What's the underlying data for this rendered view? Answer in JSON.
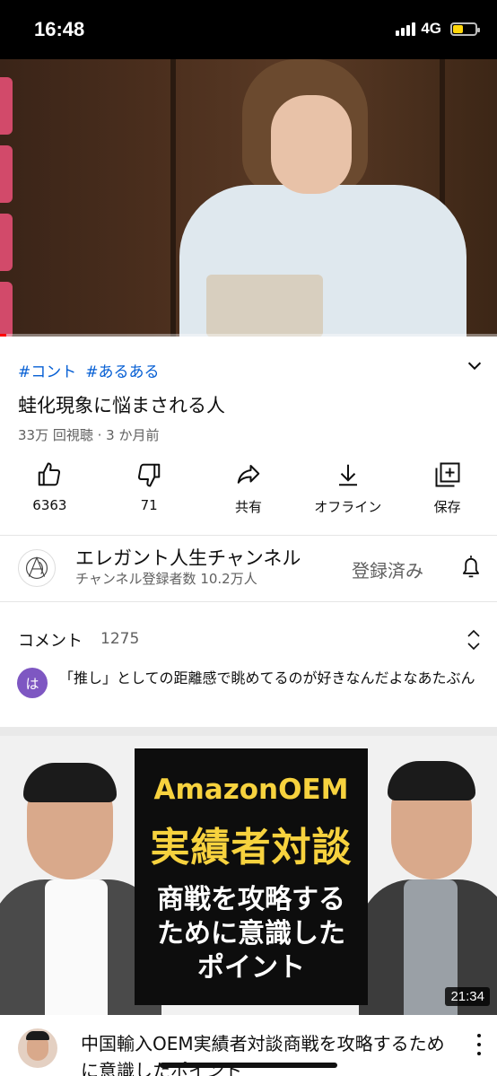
{
  "status_bar": {
    "time": "16:48",
    "network": "4G",
    "battery_fraction": 0.42
  },
  "video": {
    "hashtags": [
      "#コント",
      "#あるある"
    ],
    "title": "蛙化現象に悩まされる人",
    "meta": "33万 回視聴 · 3 か月前",
    "progress_fraction": 0.013
  },
  "actions": [
    {
      "icon": "thumbs-up-icon",
      "label": "6363"
    },
    {
      "icon": "thumbs-down-icon",
      "label": "71"
    },
    {
      "icon": "share-icon",
      "label": "共有"
    },
    {
      "icon": "download-icon",
      "label": "オフライン"
    },
    {
      "icon": "save-playlist-icon",
      "label": "保存"
    }
  ],
  "channel": {
    "name": "エレガント人生チャンネル",
    "subscribers": "チャンネル登録者数 10.2万人",
    "subscribe_state": "登録済み"
  },
  "comments": {
    "header": "コメント",
    "count": "1275",
    "top_comment": {
      "avatar_letter": "は",
      "avatar_color": "#7e57c2",
      "text": "「推し」としての距離感で眺めてるのが好きなんだよなあたぶん"
    }
  },
  "recommended": {
    "thumb_lines": [
      "AmazonOEM",
      "実績者対談",
      "商戦を攻略する",
      "ために意識した",
      "ポイント"
    ],
    "duration": "21:34",
    "title": "中国輸入OEM実績者対談商戦を攻略するために意識したポイント"
  }
}
